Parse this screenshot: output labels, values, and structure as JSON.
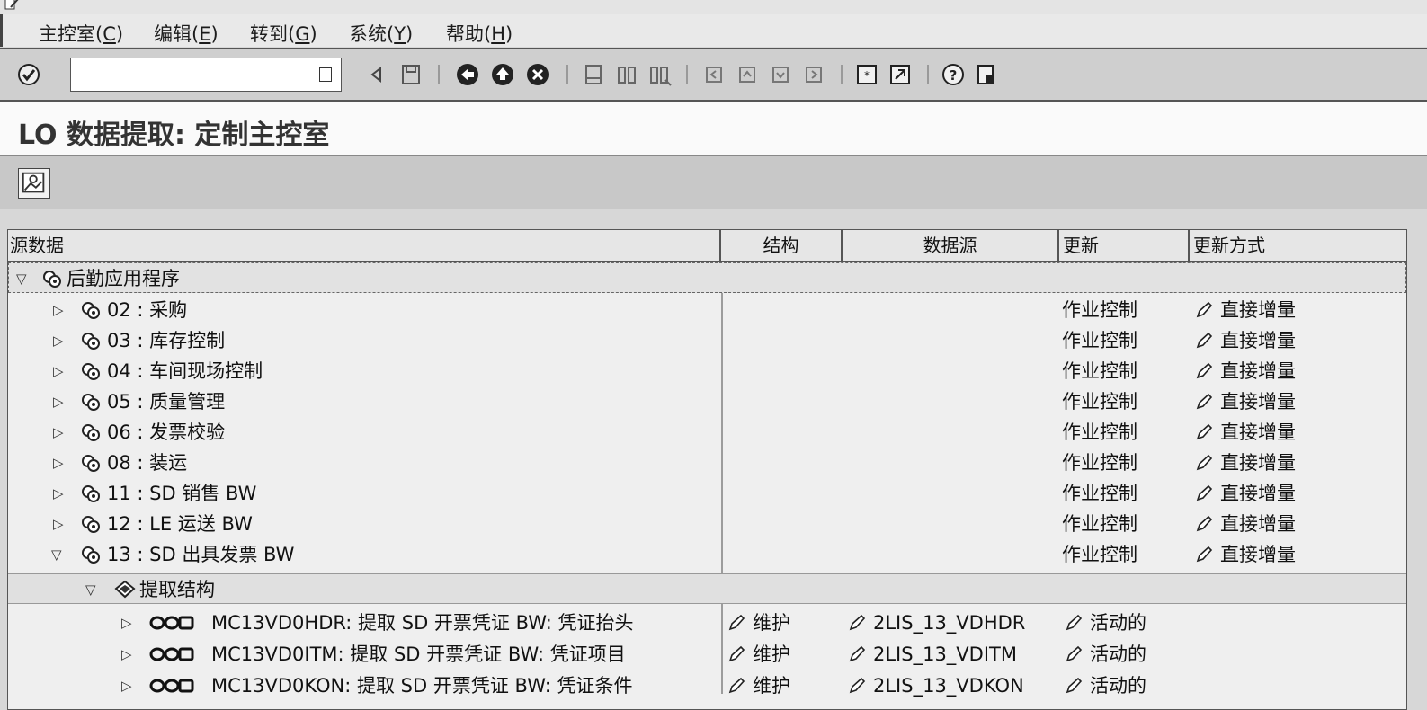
{
  "menu": [
    {
      "label": "主控室(",
      "key": "C",
      "tail": ")"
    },
    {
      "label": "编辑(",
      "key": "E",
      "tail": ")"
    },
    {
      "label": "转到(",
      "key": "G",
      "tail": ")"
    },
    {
      "label": "系统(",
      "key": "Y",
      "tail": ")"
    },
    {
      "label": "帮助(",
      "key": "H",
      "tail": ")"
    }
  ],
  "command_field": {
    "value": ""
  },
  "page": {
    "title": "LO 数据提取: 定制主控室"
  },
  "table": {
    "headers": {
      "source": "源数据",
      "structure": "结构",
      "datasource": "数据源",
      "update": "更新",
      "update_mode": "更新方式"
    },
    "root": {
      "label": "后勤应用程序"
    },
    "apps": [
      {
        "label": "02 : 采购",
        "update": "作业控制",
        "mode": "直接增量"
      },
      {
        "label": "03 : 库存控制",
        "update": "作业控制",
        "mode": "直接增量"
      },
      {
        "label": "04 : 车间现场控制",
        "update": "作业控制",
        "mode": "直接增量"
      },
      {
        "label": "05 : 质量管理",
        "update": "作业控制",
        "mode": "直接增量"
      },
      {
        "label": "06 : 发票校验",
        "update": "作业控制",
        "mode": "直接增量"
      },
      {
        "label": "08 : 装运",
        "update": "作业控制",
        "mode": "直接增量"
      },
      {
        "label": "11 : SD 销售 BW",
        "update": "作业控制",
        "mode": "直接增量"
      },
      {
        "label": "12 : LE 运送 BW",
        "update": "作业控制",
        "mode": "直接增量"
      },
      {
        "label": "13 : SD 出具发票 BW",
        "update": "作业控制",
        "mode": "直接增量"
      }
    ],
    "extract_node": {
      "label": "提取结构"
    },
    "structures": [
      {
        "label": "MC13VD0HDR: 提取 SD 开票凭证 BW: 凭证抬头",
        "structure": "维护",
        "datasource": "2LIS_13_VDHDR",
        "update": "活动的"
      },
      {
        "label": "MC13VD0ITM: 提取 SD 开票凭证 BW: 凭证项目",
        "structure": "维护",
        "datasource": "2LIS_13_VDITM",
        "update": "活动的"
      },
      {
        "label": "MC13VD0KON: 提取 SD 开票凭证 BW: 凭证条件",
        "structure": "维护",
        "datasource": "2LIS_13_VDKON",
        "update": "活动的"
      }
    ]
  },
  "icons": [
    "enter-icon",
    "back-icon",
    "exit-icon",
    "cancel-icon",
    "print-icon",
    "find-icon",
    "find-next-icon",
    "first-page-icon",
    "prev-page-icon",
    "next-page-icon",
    "last-page-icon",
    "new-session-icon",
    "shortcut-icon",
    "help-icon",
    "customize-layout-icon",
    "pencil-icon",
    "gear-icon",
    "structure-icon"
  ]
}
